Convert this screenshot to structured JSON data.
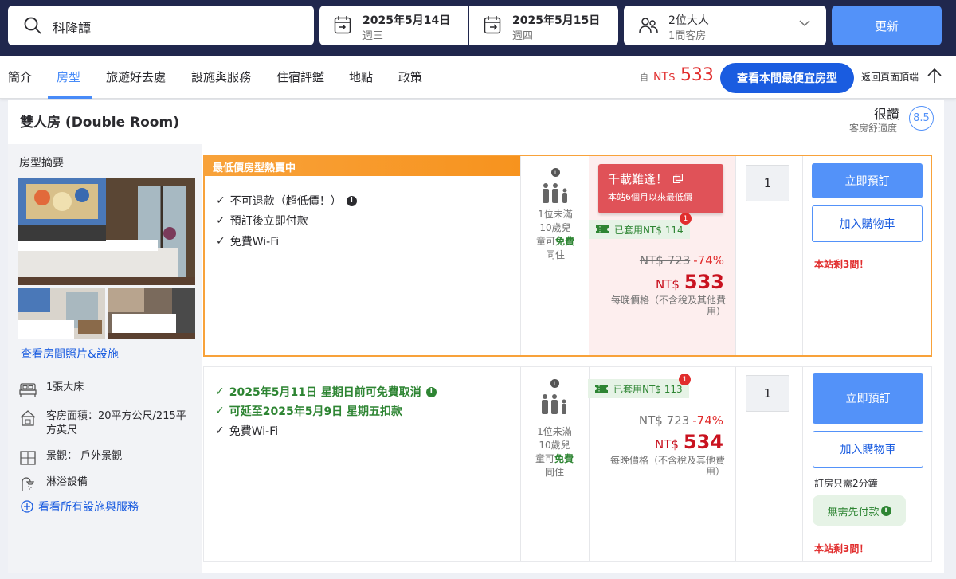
{
  "search": {
    "destination": "科隆譚",
    "checkin": {
      "date": "2025年5月14日",
      "day": "週三"
    },
    "checkout": {
      "date": "2025年5月15日",
      "day": "週四"
    },
    "occupancy": {
      "guests": "2位大人",
      "rooms": "1間客房"
    },
    "update_label": "更新"
  },
  "nav": {
    "tabs": [
      "簡介",
      "房型",
      "旅遊好去處",
      "設施與服務",
      "住宿評鑑",
      "地點",
      "政策"
    ],
    "active_tab": "房型",
    "price_from": "自",
    "price_currency": "NT$",
    "price_amount": "533",
    "cheapest_label": "查看本間最便宜房型",
    "back_top_label": "返回頁面頂端"
  },
  "room": {
    "title": "雙人房 (Double Room)",
    "rating_word": "很讚",
    "rating_label": "客房舒適度",
    "rating_score": "8.5",
    "summary_label": "房型摘要",
    "photos_link": "查看房間照片&設施",
    "features": [
      {
        "icon": "bed-icon",
        "text": "1張大床"
      },
      {
        "icon": "house-area-icon",
        "text": "客房面積：20平方公尺/215平方英尺"
      },
      {
        "icon": "window-view-icon",
        "text": "景觀： 戶外景觀"
      },
      {
        "icon": "shower-icon",
        "text": "淋浴設備"
      }
    ],
    "all_facilities_link": "看看所有設施與服務"
  },
  "offers": [
    {
      "banner": "最低價房型熱賣中",
      "benefits": [
        "不可退款（超低價！）",
        "預訂後立即付款",
        "免費Wi-Fi"
      ],
      "occupancy_text": [
        "1位未滿",
        "10歲兒",
        "童可",
        "免費",
        "同住"
      ],
      "deal_title": "千載難逢！",
      "deal_sub": "本站6個月以來最低價",
      "coupon": "已套用NT$ 114",
      "coupon_badge": "1",
      "original_price": "NT$ 723",
      "discount": "-74%",
      "currency": "NT$",
      "price": "533",
      "per_night": "每晚價格（不含稅及其他費用）",
      "quantity": "1",
      "book_label": "立即預訂",
      "cart_label": "加入購物車",
      "rooms_left": "本站剩3間！"
    },
    {
      "benefits": [
        "2025年5月11日 星期日前可免費取消",
        "可延至2025年5月9日 星期五扣款",
        "免費Wi-Fi"
      ],
      "occupancy_text": [
        "1位未滿",
        "10歲兒",
        "童可",
        "免費",
        "同住"
      ],
      "coupon": "已套用NT$ 113",
      "coupon_badge": "1",
      "original_price": "NT$ 723",
      "discount": "-74%",
      "currency": "NT$",
      "price": "534",
      "per_night": "每晚價格（不含稅及其他費用）",
      "quantity": "1",
      "book_label": "立即預訂",
      "cart_label": "加入購物車",
      "book_time": "訂房只需2分鐘",
      "no_prepay": "無需先付款",
      "rooms_left": "本站剩3間！"
    }
  ]
}
